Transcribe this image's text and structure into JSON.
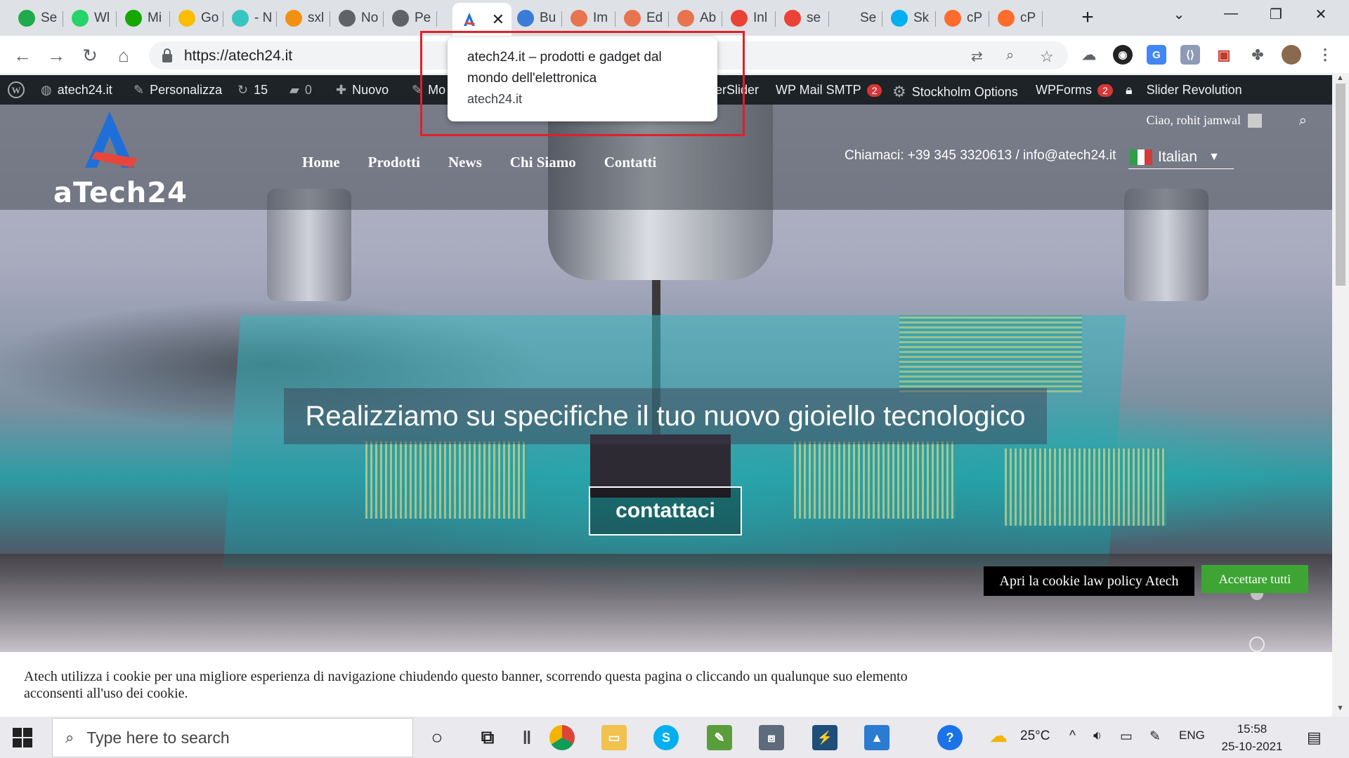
{
  "browser": {
    "tabs": [
      {
        "label": "Se",
        "icon": "green-f-icon",
        "color": "#1faa4b"
      },
      {
        "label": "Wl",
        "icon": "whatsapp-icon",
        "color": "#25d366"
      },
      {
        "label": "Mi",
        "icon": "upwork-icon",
        "color": "#14a800"
      },
      {
        "label": "Go",
        "icon": "keep-icon",
        "color": "#fbbc04"
      },
      {
        "label": "- N",
        "icon": "swirl-icon",
        "color": "#36c5c0"
      },
      {
        "label": "sxl",
        "icon": "phpmyadmin-icon",
        "color": "#f29111"
      },
      {
        "label": "No",
        "icon": "globe-icon",
        "color": "#5f6368"
      },
      {
        "label": "Pe",
        "icon": "globe-icon",
        "color": "#5f6368"
      },
      {
        "label": "",
        "icon": "atech-icon",
        "color": "#2b6cd9",
        "active": true
      },
      {
        "label": "Bu",
        "icon": "bucket-icon",
        "color": "#3a7bd5"
      },
      {
        "label": "Im",
        "icon": "mail-stack-icon",
        "color": "#e8744f"
      },
      {
        "label": "Ed",
        "icon": "mail-stack-icon",
        "color": "#e8744f"
      },
      {
        "label": "Ab",
        "icon": "mail-stack-icon",
        "color": "#e8744f"
      },
      {
        "label": "Inl",
        "icon": "gmail-icon",
        "color": "#ea4335"
      },
      {
        "label": "se",
        "icon": "gmail-icon",
        "color": "#ea4335"
      },
      {
        "label": "Se",
        "icon": "blank-icon",
        "color": "#dee1e6"
      },
      {
        "label": "Sk",
        "icon": "skype-icon",
        "color": "#00aff0"
      },
      {
        "label": "cP",
        "icon": "cpanel-icon",
        "color": "#ff6c2c"
      },
      {
        "label": "cP",
        "icon": "cpanel-icon",
        "color": "#ff6c2c"
      }
    ],
    "new_tab": "+",
    "url": "https://atech24.it",
    "hovercard": {
      "title": "atech24.it – prodotti e gadget dal mondo dell'elettronica",
      "domain": "atech24.it"
    }
  },
  "wpbar": {
    "site_name": "atech24.it",
    "customize": "Personalizza",
    "updates": "15",
    "comments": "0",
    "new": "Nuovo",
    "edit_partial": "Mo",
    "layerslider": "erSlider",
    "mail_smtp": "WP Mail SMTP",
    "mail_smtp_badge": "2",
    "stockholm": "Stockholm Options",
    "wpforms": "WPForms",
    "wpforms_badge": "2",
    "slider_revolution": "Slider Revolution"
  },
  "site": {
    "logo_text": "aTech24",
    "greeting": "Ciao, rohit jamwal",
    "nav": [
      "Home",
      "Prodotti",
      "News",
      "Chi Siamo",
      "Contatti"
    ],
    "contact_line": "Chiamaci: +39 345 3320613 / info@atech24.it",
    "language": "Italian",
    "slide_title": "Realizziamo su specifiche il tuo nuovo gioiello tecnologico",
    "cta": "contattaci",
    "cookie_text": "Atech utilizza i cookie per una migliore esperienza di navigazione chiudendo questo banner, scorrendo questa pagina o cliccando un qualunque suo elemento acconsenti all'uso dei cookie.",
    "cookie_policy_button": "Apri la cookie law policy Atech",
    "cookie_accept_button": "Accettare tutti"
  },
  "taskbar": {
    "search_placeholder": "Type here to search",
    "temperature": "25°C",
    "language": "ENG",
    "time": "15:58",
    "date": "25-10-2021"
  },
  "colors": {
    "accept_green": "#3ea534",
    "highlight_red": "#e0202a",
    "wp_bar": "#1d2327",
    "badge_red": "#d63638"
  }
}
